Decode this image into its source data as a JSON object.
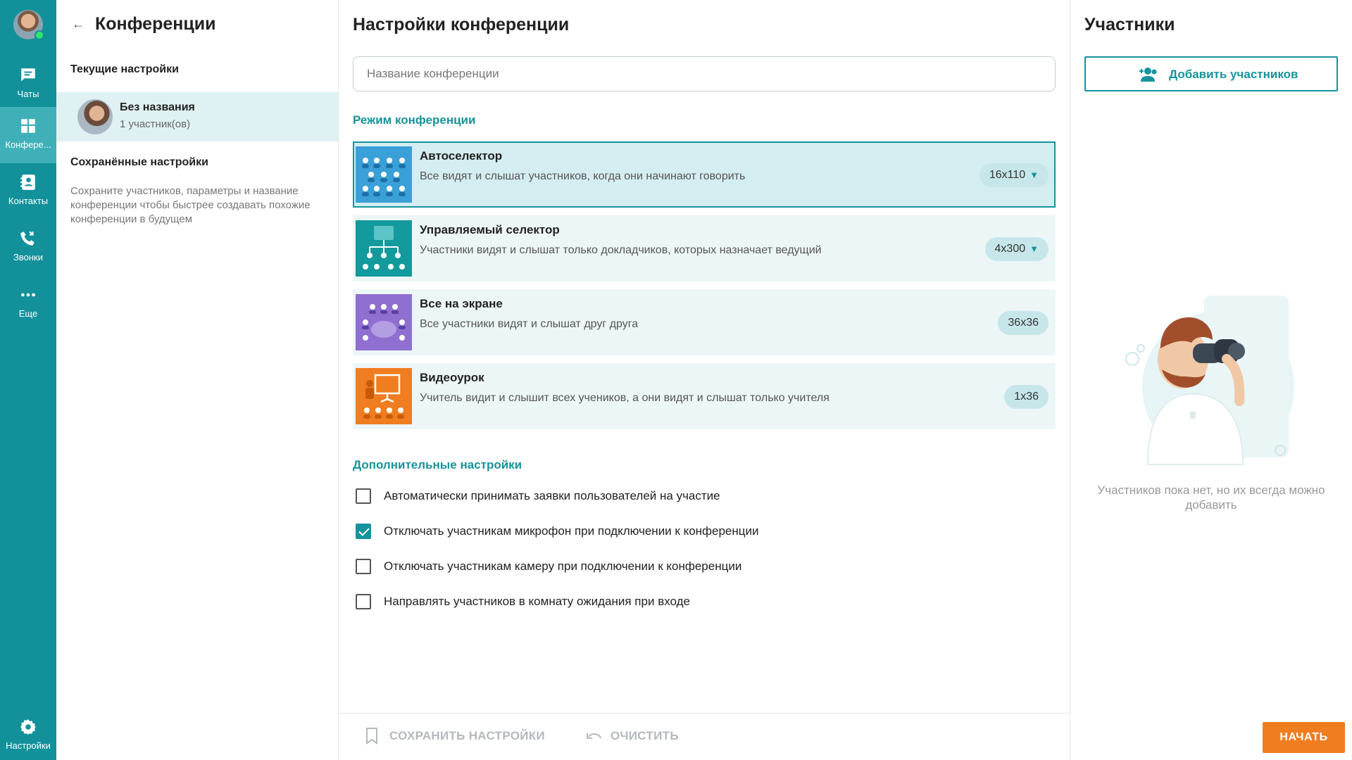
{
  "rail": {
    "items": [
      {
        "label": "Чаты",
        "icon": "chat-icon"
      },
      {
        "label": "Конфере...",
        "icon": "conference-icon"
      },
      {
        "label": "Контакты",
        "icon": "contacts-icon"
      },
      {
        "label": "Звонки",
        "icon": "calls-icon"
      },
      {
        "label": "Еще",
        "icon": "more-icon"
      }
    ],
    "settings_label": "Настройки",
    "accent_color": "#12919a",
    "active_color": "#3fb0b8",
    "status_color": "#2ee66b"
  },
  "conferences": {
    "title": "Конференции",
    "current_heading": "Текущие настройки",
    "current_item": {
      "name": "Без названия",
      "sub": "1 участник(ов)"
    },
    "saved_heading": "Сохранённые настройки",
    "saved_description": "Сохраните участников, параметры и название конференции чтобы быстрее создавать похожие конференции в будущем"
  },
  "settings": {
    "title": "Настройки конференции",
    "name_placeholder": "Название конференции",
    "name_value": "",
    "mode_heading": "Режим конференции",
    "modes": [
      {
        "title": "Автоселектор",
        "desc": "Все видят и слышат участников, когда они начинают говорить",
        "size": "16x110",
        "has_dropdown": true,
        "selected": true,
        "icon": "autoselector-icon",
        "color": "#3aa0d8"
      },
      {
        "title": "Управляемый селектор",
        "desc": "Участники видят и слышат только докладчиков, которых назначает ведущий",
        "size": "4x300",
        "has_dropdown": true,
        "selected": false,
        "icon": "managed-selector-icon",
        "color": "#139a9c"
      },
      {
        "title": "Все на экране",
        "desc": "Все участники видят и слышат друг друга",
        "size": "36x36",
        "has_dropdown": false,
        "selected": false,
        "icon": "all-on-screen-icon",
        "color": "#8f6fd0"
      },
      {
        "title": "Видеоурок",
        "desc": "Учитель видит и слышит всех учеников, а они видят и слышат только учителя",
        "size": "1x36",
        "has_dropdown": false,
        "selected": false,
        "icon": "video-lesson-icon",
        "color": "#f07d1f"
      }
    ],
    "extra_heading": "Дополнительные настройки",
    "options": [
      {
        "label": "Автоматически принимать заявки пользователей на участие",
        "checked": false
      },
      {
        "label": "Отключать участникам микрофон при подключении к конференции",
        "checked": true
      },
      {
        "label": "Отключать участникам камеру при подключении к конференции",
        "checked": false
      },
      {
        "label": "Направлять участников в комнату ожидания при входе",
        "checked": false
      }
    ],
    "save_label": "СОХРАНИТЬ НАСТРОЙКИ",
    "clear_label": "ОЧИСТИТЬ"
  },
  "participants": {
    "title": "Участники",
    "add_label": "Добавить участников",
    "empty_text": "Участников пока нет, но их всегда можно добавить",
    "start_label": "НАЧАТЬ",
    "start_color": "#f07d1f"
  }
}
